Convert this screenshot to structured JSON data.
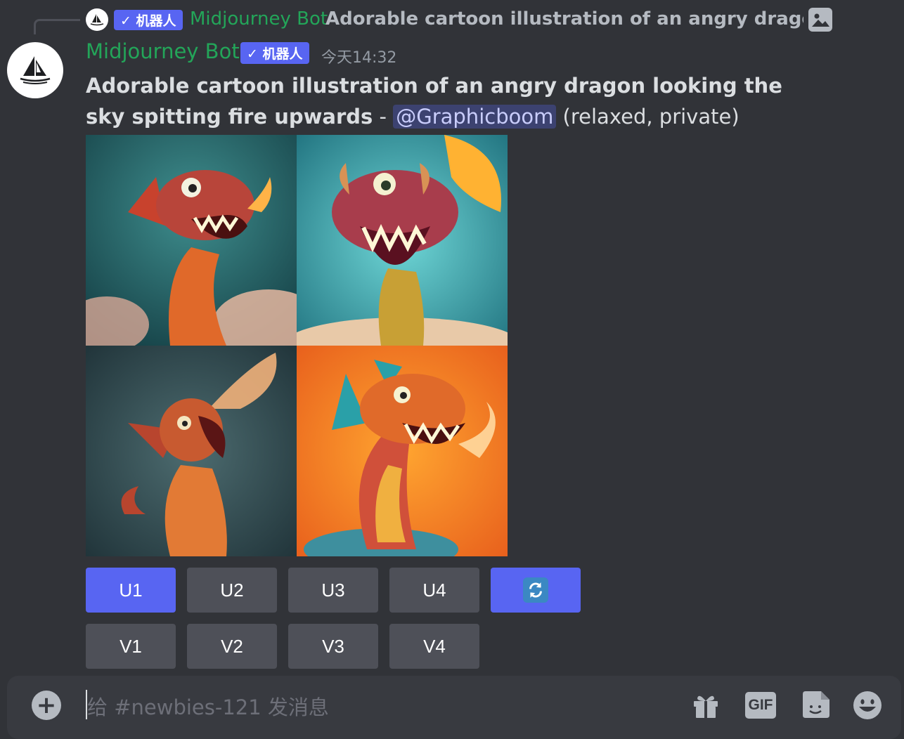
{
  "reply": {
    "bot_tag": "✓ 机器人",
    "username": "Midjourney Bot",
    "preview_text": "Adorable cartoon illustration of an angry dragon lookin"
  },
  "message": {
    "username": "Midjourney Bot",
    "bot_tag": "✓ 机器人",
    "timestamp": "今天14:32",
    "prompt": "Adorable cartoon illustration of an angry dragon looking the sky spitting fire upwards",
    "separator": " - ",
    "mention": "@Graphicboom",
    "status": " (relaxed, private)"
  },
  "buttons": {
    "row1": [
      {
        "label": "U1",
        "active": true
      },
      {
        "label": "U2",
        "active": false
      },
      {
        "label": "U3",
        "active": false
      },
      {
        "label": "U4",
        "active": false
      }
    ],
    "row2": [
      {
        "label": "V1"
      },
      {
        "label": "V2"
      },
      {
        "label": "V3"
      },
      {
        "label": "V4"
      }
    ],
    "reroll_icon": "refresh-icon"
  },
  "composer": {
    "placeholder": "给 #newbies-121 发消息",
    "icons": [
      "add-circle-icon",
      "gift-icon",
      "gif-icon",
      "sticker-icon",
      "emoji-icon"
    ],
    "gif_label": "GIF"
  },
  "colors": {
    "background": "#313338",
    "accent": "#5865f2",
    "username": "#23a559",
    "secondary_button": "#4e5058"
  }
}
